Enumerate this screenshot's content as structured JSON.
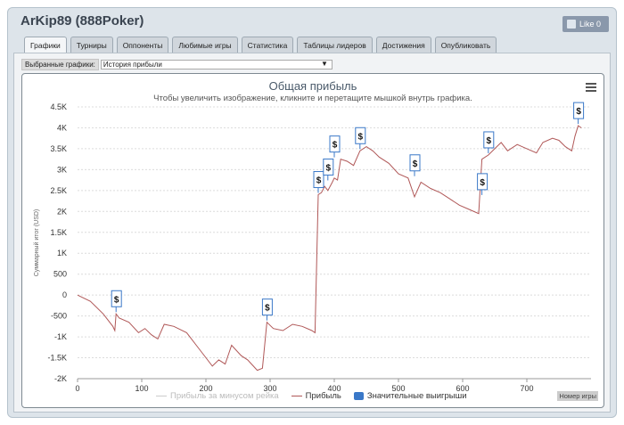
{
  "window": {
    "title": "ArKip89 (888Poker)",
    "like_label": "Like 0"
  },
  "tabs": [
    {
      "label": "Графики",
      "active": true
    },
    {
      "label": "Турниры",
      "active": false
    },
    {
      "label": "Оппоненты",
      "active": false
    },
    {
      "label": "Любимые игры",
      "active": false
    },
    {
      "label": "Статистика",
      "active": false
    },
    {
      "label": "Таблицы лидеров",
      "active": false
    },
    {
      "label": "Достижения",
      "active": false
    },
    {
      "label": "Опубликовать",
      "active": false
    }
  ],
  "selector": {
    "label": "Выбранные графики:",
    "value": "История прибыли",
    "arrow": "▼"
  },
  "chart_data": {
    "type": "line",
    "title": "Общая прибыль",
    "subtitle": "Чтобы увеличить изображение, кликните и перетащите мышкой внутрь графика.",
    "ylabel": "Суммарный итог (USD)",
    "xlabel": "Номер игры",
    "xlim": [
      0,
      800
    ],
    "ylim": [
      -2000,
      4500
    ],
    "x_ticks": [
      0,
      100,
      200,
      300,
      400,
      500,
      600,
      700
    ],
    "y_ticks": [
      {
        "v": -2000,
        "label": "-2K"
      },
      {
        "v": -1500,
        "label": "-1.5K"
      },
      {
        "v": -1000,
        "label": "-1K"
      },
      {
        "v": -500,
        "label": "-500"
      },
      {
        "v": 0,
        "label": "0"
      },
      {
        "v": 500,
        "label": "500"
      },
      {
        "v": 1000,
        "label": "1K"
      },
      {
        "v": 1500,
        "label": "1.5K"
      },
      {
        "v": 2000,
        "label": "2K"
      },
      {
        "v": 2500,
        "label": "2.5K"
      },
      {
        "v": 3000,
        "label": "3K"
      },
      {
        "v": 3500,
        "label": "3.5K"
      },
      {
        "v": 4000,
        "label": "4K"
      },
      {
        "v": 4500,
        "label": "4.5K"
      }
    ],
    "grid": true,
    "series": [
      {
        "name": "Прибыль",
        "color": "#b05858",
        "points": [
          [
            0,
            0
          ],
          [
            20,
            -150
          ],
          [
            40,
            -450
          ],
          [
            55,
            -750
          ],
          [
            58,
            -850
          ],
          [
            60,
            -450
          ],
          [
            65,
            -550
          ],
          [
            80,
            -650
          ],
          [
            95,
            -900
          ],
          [
            105,
            -800
          ],
          [
            115,
            -950
          ],
          [
            125,
            -1050
          ],
          [
            135,
            -700
          ],
          [
            150,
            -750
          ],
          [
            170,
            -900
          ],
          [
            185,
            -1200
          ],
          [
            200,
            -1500
          ],
          [
            210,
            -1700
          ],
          [
            220,
            -1550
          ],
          [
            230,
            -1650
          ],
          [
            240,
            -1200
          ],
          [
            255,
            -1450
          ],
          [
            265,
            -1550
          ],
          [
            280,
            -1800
          ],
          [
            288,
            -1750
          ],
          [
            295,
            -650
          ],
          [
            305,
            -800
          ],
          [
            320,
            -850
          ],
          [
            335,
            -700
          ],
          [
            350,
            -750
          ],
          [
            365,
            -850
          ],
          [
            370,
            -900
          ],
          [
            375,
            2400
          ],
          [
            380,
            2450
          ],
          [
            385,
            2600
          ],
          [
            390,
            2500
          ],
          [
            397,
            2700
          ],
          [
            400,
            2800
          ],
          [
            405,
            2750
          ],
          [
            410,
            3250
          ],
          [
            420,
            3200
          ],
          [
            430,
            3100
          ],
          [
            440,
            3450
          ],
          [
            450,
            3550
          ],
          [
            460,
            3450
          ],
          [
            470,
            3300
          ],
          [
            485,
            3150
          ],
          [
            500,
            2900
          ],
          [
            515,
            2800
          ],
          [
            525,
            2350
          ],
          [
            535,
            2700
          ],
          [
            550,
            2550
          ],
          [
            565,
            2450
          ],
          [
            580,
            2300
          ],
          [
            595,
            2150
          ],
          [
            610,
            2050
          ],
          [
            625,
            1950
          ],
          [
            630,
            3250
          ],
          [
            640,
            3350
          ],
          [
            650,
            3500
          ],
          [
            660,
            3650
          ],
          [
            670,
            3450
          ],
          [
            685,
            3600
          ],
          [
            700,
            3500
          ],
          [
            715,
            3400
          ],
          [
            725,
            3650
          ],
          [
            740,
            3750
          ],
          [
            750,
            3700
          ],
          [
            760,
            3550
          ],
          [
            770,
            3450
          ],
          [
            775,
            3800
          ],
          [
            780,
            4050
          ],
          [
            785,
            4000
          ]
        ]
      }
    ],
    "legend": [
      {
        "name": "Прибыль за минусом рейка",
        "color": "#cccccc",
        "kind": "line",
        "muted": true
      },
      {
        "name": "Прибыль",
        "color": "#b05858",
        "kind": "line",
        "muted": false
      },
      {
        "name": "Значительные выигрыши",
        "color": "#3a78c8",
        "kind": "box",
        "muted": false
      }
    ],
    "flags": [
      {
        "x": 60,
        "y": -450,
        "label": "$"
      },
      {
        "x": 295,
        "y": -650,
        "label": "$"
      },
      {
        "x": 375,
        "y": 2400,
        "label": "$"
      },
      {
        "x": 390,
        "y": 2700,
        "label": "$"
      },
      {
        "x": 400,
        "y": 3250,
        "label": "$"
      },
      {
        "x": 440,
        "y": 3450,
        "label": "$"
      },
      {
        "x": 525,
        "y": 2800,
        "label": "$"
      },
      {
        "x": 630,
        "y": 2350,
        "label": "$"
      },
      {
        "x": 640,
        "y": 3350,
        "label": "$"
      },
      {
        "x": 780,
        "y": 4050,
        "label": "$"
      }
    ]
  }
}
